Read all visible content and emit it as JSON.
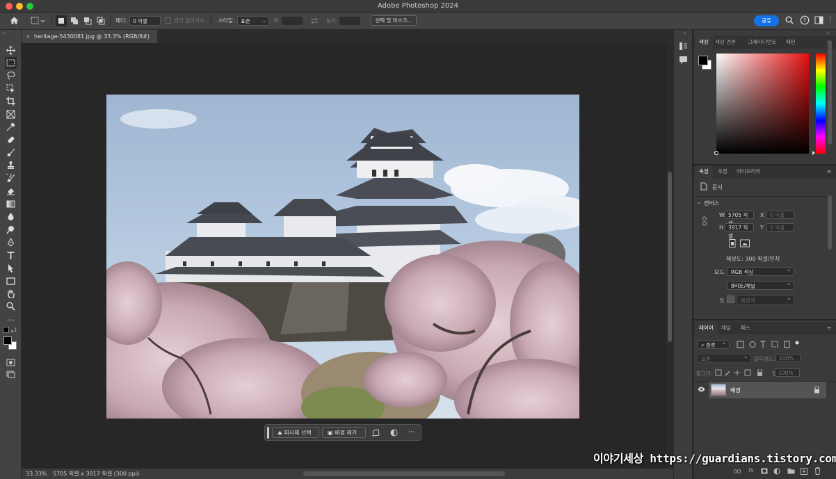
{
  "window": {
    "title": "Adobe Photoshop 2024"
  },
  "options_bar": {
    "feather_label": "페더:",
    "feather_value": "0 픽셀",
    "anti_alias_label": "앤티 앨리어스",
    "style_label": "스타일:",
    "style_value": "표준",
    "width_label": "폭:",
    "height_label": "높이:",
    "select_mask_button": "선택 및 마스크...",
    "share_button": "공유"
  },
  "document_tab": {
    "title": "heritage-5430081.jpg @ 33.3% (RGB/8#)",
    "close": "×"
  },
  "context_bar": {
    "select_subject": "피사체 선택",
    "remove_background": "배경 제거",
    "more": "···"
  },
  "status_bar": {
    "zoom": "33.33%",
    "info": "5705 픽셀 x 3917 픽셀 (300 ppi)",
    "arrow": "›"
  },
  "color_panel": {
    "tabs": [
      "색상",
      "색상 견본",
      "그레이디언트",
      "패턴"
    ],
    "active_tab": 0,
    "foreground": "#000000",
    "background": "#ffffff"
  },
  "properties_panel": {
    "tabs": [
      "속성",
      "조정",
      "라이브러리"
    ],
    "doc_label": "문서",
    "canvas_section": "캔버스",
    "w_label": "W",
    "w_value": "5705 픽셀",
    "h_label": "H",
    "h_value": "3917 픽셀",
    "x_label": "X",
    "x_placeholder": "0 픽셀",
    "y_label": "Y",
    "y_placeholder": "0 픽셀",
    "resolution": "해상도: 300 픽셀/인치",
    "mode_label": "모드",
    "mode_value": "RGB 색상",
    "bit_value": "8비트/채널",
    "fill_label": "칠",
    "fill_value": "배경색"
  },
  "layers_panel": {
    "tabs": [
      "레이어",
      "채널",
      "패스"
    ],
    "filter_kind": "종류",
    "blend_mode": "표준",
    "opacity_label": "불투명도:",
    "opacity_value": "100%",
    "lock_label": "잠그기:",
    "fill_label": "칠:",
    "fill_value": "100%",
    "layers": [
      {
        "name": "배경",
        "visible": true,
        "locked": true
      }
    ],
    "footer_fx": "fx"
  },
  "watermark": "이야기세상 https://guardians.tistory.com",
  "colors": {
    "accent": "#1473e6",
    "panel_bg": "#3a3a3a",
    "workspace_bg": "#272727"
  }
}
